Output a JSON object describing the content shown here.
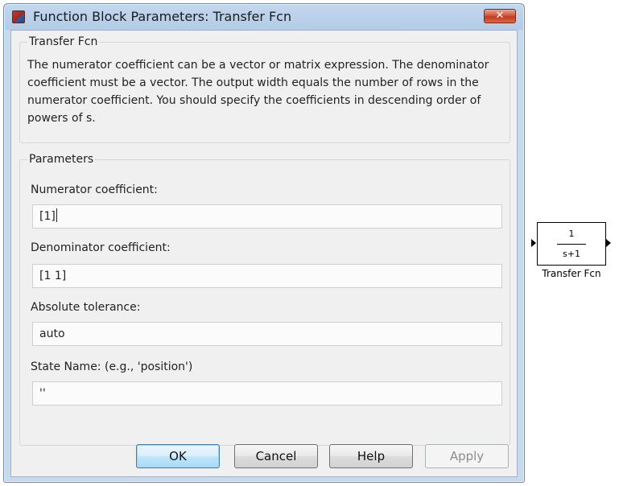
{
  "window": {
    "title": "Function Block Parameters: Transfer Fcn",
    "close_label": "✕"
  },
  "block_info": {
    "group_title": "Transfer Fcn",
    "description": "The numerator coefficient can be a vector or matrix expression. The denominator coefficient must be a vector. The output width equals the number of rows in the numerator coefficient. You should specify the coefficients in descending order of powers of s."
  },
  "parameters": {
    "group_title": "Parameters",
    "numerator": {
      "label": "Numerator coefficient:",
      "value": "[1]"
    },
    "denominator": {
      "label": "Denominator coefficient:",
      "value": "[1 1]"
    },
    "tolerance": {
      "label": "Absolute tolerance:",
      "value": "auto"
    },
    "state_name": {
      "label": "State Name: (e.g., 'position')",
      "value": "''"
    }
  },
  "buttons": {
    "ok": "OK",
    "cancel": "Cancel",
    "help": "Help",
    "apply": "Apply"
  },
  "diagram_block": {
    "numerator": "1",
    "denominator": "s+1",
    "name": "Transfer Fcn"
  }
}
